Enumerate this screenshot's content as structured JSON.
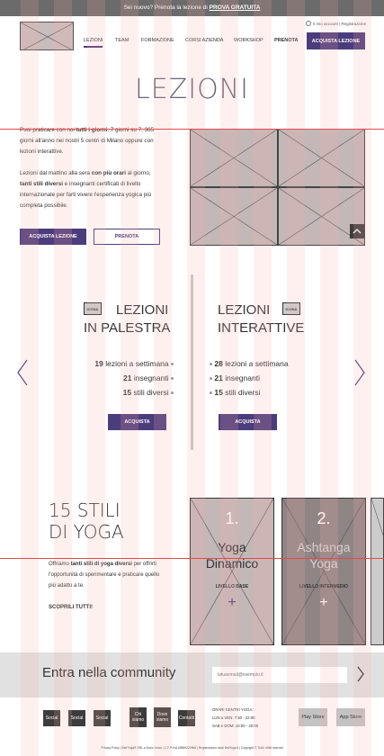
{
  "topbar": {
    "text": "Sei nuovo? Prenota la lezione di",
    "promo": "PROVA GRATUITA"
  },
  "header": {
    "account_text": "Il mio account | Registrazione"
  },
  "nav": {
    "items": [
      "LEZIONI",
      "TEAM",
      "FORMAZIONE",
      "CORSI AZIENDA",
      "WORKSHOP",
      "PRENOTA"
    ],
    "cta": "ACQUISTA LEZIONE"
  },
  "page_title": "LEZIONI",
  "intro": {
    "p1_a": "Puoi praticare con noi ",
    "p1_b": "tutti i giorni",
    "p1_c": ", 7 giorni su 7, 365 giorni all'anno nei nostri 5 centri di Milano oppure con lezioni interattive.",
    "p2_a": "Lezioni dal mattino alla sera ",
    "p2_b": "con più orari",
    "p2_c": " al giorno, ",
    "p2_d": "tanti stili diversi",
    "p2_e": " e insegnanti certificati di livello internazionale per farti vivere l'esperienza yogica più completa possibile.",
    "btn_buy": "ACQUISTA LEZIONE",
    "btn_book": "PRENOTA"
  },
  "palestra": {
    "icon_label": "ICONA",
    "title_1": "LEZIONI",
    "title_2": "IN PALESTRA",
    "stat1_num": "19",
    "stat1_txt": " lezioni a settimana",
    "stat2_num": "21",
    "stat2_txt": " insegnanti",
    "stat3_num": "15",
    "stat3_txt": " stili diversi",
    "btn": "ACQUISTA"
  },
  "interattive": {
    "icon_label": "ICONA",
    "title_1": "LEZIONI",
    "title_2": "INTERATTIVE",
    "stat1_num": "28",
    "stat1_txt": " lezioni a settimana",
    "stat2_num": "21",
    "stat2_txt": " insegnanti",
    "stat3_num": "15",
    "stat3_txt": " stili diversi",
    "btn": "ACQUISTA"
  },
  "stili": {
    "title_1": "15 STILI",
    "title_2": "DI YOGA",
    "text_a": "Offriamo ",
    "text_b": "tanti stili di yoga diversi",
    "text_c": " per offrirti l'opportunità di sperimentare e praticare quello più adatto a te.",
    "link": "SCOPRILI TUTTI!",
    "cards": [
      {
        "num": "1.",
        "name_1": "Yoga",
        "name_2": "Dinamico",
        "level": "LIVELLO BASE",
        "plus": "+"
      },
      {
        "num": "2.",
        "name_1": "Ashtanga",
        "name_2": "Yoga",
        "level": "LIVELLO INTERMEDIO",
        "plus": "+"
      }
    ]
  },
  "community": {
    "title": "Entra nella community",
    "placeholder": "latuaemail@esempio.it"
  },
  "footer": {
    "social": [
      "Social",
      "Social",
      "Social"
    ],
    "links": [
      "Chi siamo",
      "Dove siamo",
      "Contatti"
    ],
    "hours_title": "ORARI CENTRI YOGA:",
    "hours_1": "LUN a VEN:   7:30 - 22:00",
    "hours_2": "SAB e DOM: 10:00 - 20:00",
    "play_store": "Play Store",
    "app_store": "App Store",
    "legal": "Privacy Policy | Bell'Yoga® SRL a Socio Unico | C.F./P.IVA 08569220965 | Registrazione studi BellYoga.it | Copyright © Tutti i diritti riservati"
  },
  "colors": {
    "accent": "#4b3c7c",
    "placeholder": "#c3b7b7",
    "topbar": "#6b6b6b",
    "community_bg": "#e1e1e1"
  }
}
